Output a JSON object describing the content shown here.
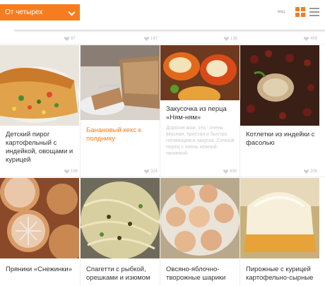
{
  "toolbar": {
    "sort_label": "От четырех",
    "view_label": "вид"
  },
  "top_likes": [
    "97",
    "147",
    "138",
    "469"
  ],
  "recipes_row1": [
    {
      "title": "Детский пирог картофельный с индейкой, овощами и курицей",
      "likes": "196"
    },
    {
      "title": "Банановый кекс к полднику",
      "likes": "324",
      "highlight": true
    },
    {
      "title": "Закусочка из перца «Ням-ням»",
      "description": "Дорогие мои, это - очень вкусная, простая и быстро готовящаяся закуска. Сочный перец с очень нежной начинкой.",
      "likes": "636"
    },
    {
      "title": "Котлетки из индейки с фасолью",
      "likes": "206"
    }
  ],
  "recipes_row2": [
    {
      "title": "Пряники «Снежинки»"
    },
    {
      "title": "Спагетти с рыбкой, орешками и изюмом"
    },
    {
      "title": "Овсяно-яблочно-творожные шарики"
    },
    {
      "title": "Пирожные с курицей картофельно-сырные"
    }
  ],
  "colors": {
    "accent": "#f57d1f",
    "muted": "#bbbbbb"
  }
}
